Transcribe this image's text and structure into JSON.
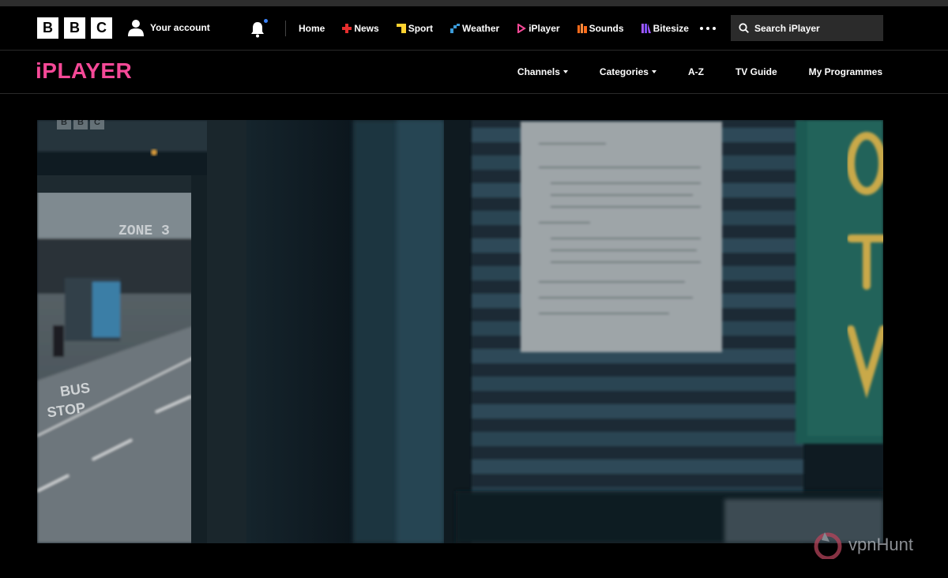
{
  "global_nav": {
    "logo_letters": [
      "B",
      "B",
      "C"
    ],
    "account_label": "Your account",
    "links": [
      {
        "label": "Home",
        "icon": "none",
        "color": ""
      },
      {
        "label": "News",
        "icon": "news-icon",
        "color": "#e62e2e"
      },
      {
        "label": "Sport",
        "icon": "sport-icon",
        "color": "#ffd230"
      },
      {
        "label": "Weather",
        "icon": "weather-icon",
        "color": "#3b9bd9"
      },
      {
        "label": "iPlayer",
        "icon": "iplayer-icon",
        "color": "#f54997"
      },
      {
        "label": "Sounds",
        "icon": "sounds-icon",
        "color": "#ff6b1a"
      },
      {
        "label": "Bitesize",
        "icon": "bitesize-icon",
        "color": "#a259ff"
      }
    ],
    "search_placeholder": "Search iPlayer"
  },
  "iplayer": {
    "logo_text": "iPLAYER",
    "logo_color": "#f54997",
    "nav": [
      {
        "label": "Channels",
        "dropdown": true
      },
      {
        "label": "Categories",
        "dropdown": true
      },
      {
        "label": "A-Z",
        "dropdown": false
      },
      {
        "label": "TV Guide",
        "dropdown": false
      },
      {
        "label": "My Programmes",
        "dropdown": false
      }
    ]
  },
  "player": {
    "watermark_letters": [
      "B",
      "B",
      "C"
    ],
    "scene_texts": [
      "ZONE 3",
      "BUS",
      "STOP"
    ]
  },
  "overlay_watermark": {
    "text": "vpnHunt"
  }
}
